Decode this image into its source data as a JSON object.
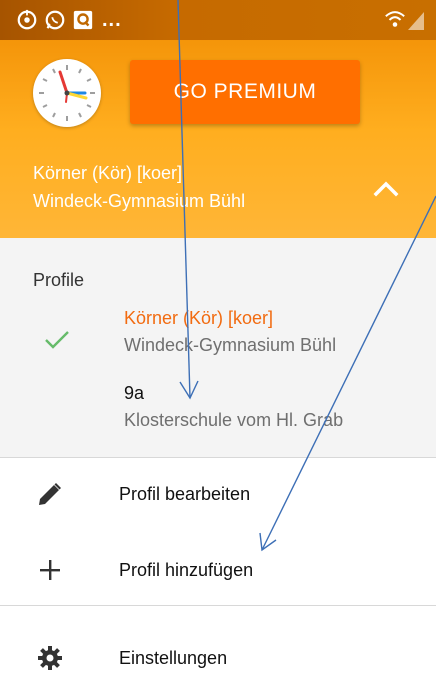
{
  "status_bar": {
    "icons": [
      "sync-icon",
      "whatsapp-icon",
      "q-app-icon"
    ],
    "overflow_text": "...",
    "right_icons": [
      "wifi-icon",
      "signal-icon"
    ]
  },
  "header": {
    "premium_button": "GO PREMIUM",
    "account_name": "Körner (Kör) [koer]",
    "account_school": "Windeck-Gymnasium Bühl",
    "toggle_icon": "chevron-up-icon"
  },
  "profiles": {
    "title": "Profile",
    "items": [
      {
        "name": "Körner (Kör) [koer]",
        "school": "Windeck-Gymnasium Bühl",
        "selected": true
      },
      {
        "name": "9a",
        "school": "Klosterschule vom Hl. Grab",
        "selected": false
      }
    ]
  },
  "menu": {
    "edit_profile": "Profil bearbeiten",
    "add_profile": "Profil hinzufügen",
    "settings": "Einstellungen"
  },
  "colors": {
    "header_orange": "#ffae1f",
    "premium_button": "#ff6f00",
    "active_profile": "#f26b10",
    "check_green": "#66bb6a",
    "annotation_arrow": "#3d6fb6"
  }
}
